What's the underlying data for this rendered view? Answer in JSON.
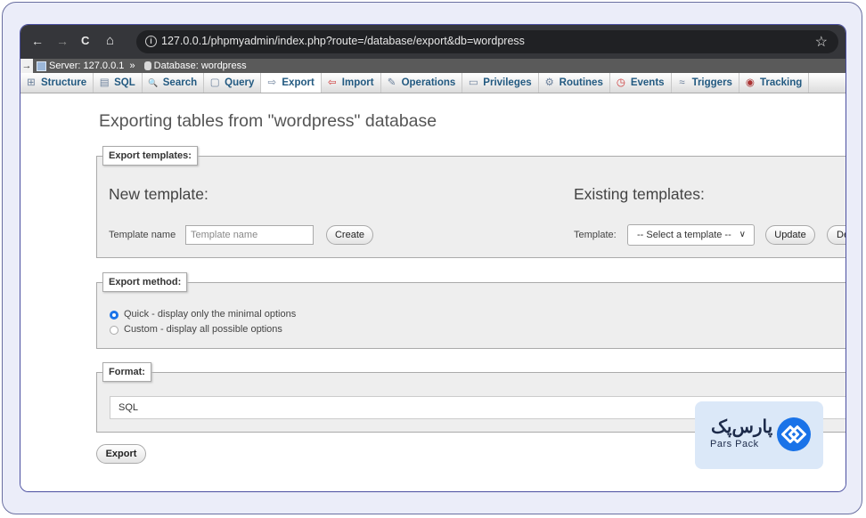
{
  "browser": {
    "url": "127.0.0.1/phpmyadmin/index.php?route=/database/export&db=wordpress",
    "back_icon": "←",
    "forward_icon": "→",
    "reload_icon": "C",
    "home_icon": "⌂",
    "star_icon": "☆"
  },
  "breadcrumb": {
    "server": "Server: 127.0.0.1",
    "sep": "»",
    "database": "Database: wordpress"
  },
  "tabs": [
    {
      "label": "Structure",
      "icon": "⊞"
    },
    {
      "label": "SQL",
      "icon": "▤"
    },
    {
      "label": "Search",
      "icon": "🔍"
    },
    {
      "label": "Query",
      "icon": "▢"
    },
    {
      "label": "Export",
      "icon": "⇨"
    },
    {
      "label": "Import",
      "icon": "⇦"
    },
    {
      "label": "Operations",
      "icon": "✎"
    },
    {
      "label": "Privileges",
      "icon": "▭"
    },
    {
      "label": "Routines",
      "icon": "⚙"
    },
    {
      "label": "Events",
      "icon": "◷"
    },
    {
      "label": "Triggers",
      "icon": "≈"
    },
    {
      "label": "Tracking",
      "icon": "◉"
    }
  ],
  "page": {
    "title": "Exporting tables from \"wordpress\" database",
    "templates": {
      "legend": "Export templates:",
      "new_heading": "New template:",
      "name_label": "Template name",
      "name_placeholder": "Template name",
      "create_button": "Create",
      "existing_heading": "Existing templates:",
      "template_label": "Template:",
      "select_value": "-- Select a template --",
      "update_button": "Update",
      "delete_button": "Delete"
    },
    "method": {
      "legend": "Export method:",
      "quick_label": "Quick - display only the minimal options",
      "custom_label": "Custom - display all possible options",
      "selected": "quick"
    },
    "format": {
      "legend": "Format:",
      "value": "SQL"
    },
    "export_button": "Export"
  },
  "badge": {
    "name_fa": "پارس‌پک",
    "name_en": "Pars Pack",
    "brand_color": "#1a73e8"
  }
}
